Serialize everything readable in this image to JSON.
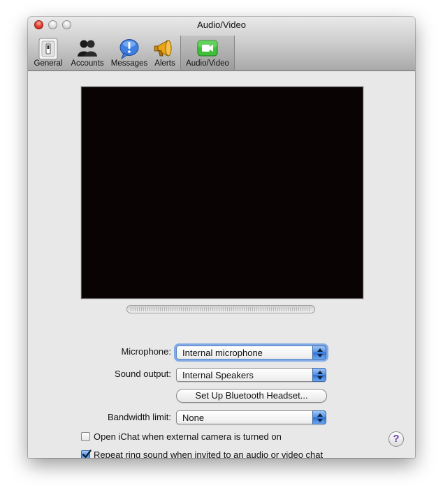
{
  "window": {
    "title": "Audio/Video"
  },
  "toolbar": {
    "items": [
      {
        "label": "General",
        "icon": "general-switch-icon",
        "selected": false
      },
      {
        "label": "Accounts",
        "icon": "accounts-people-icon",
        "selected": false
      },
      {
        "label": "Messages",
        "icon": "messages-exclamation-icon",
        "selected": false
      },
      {
        "label": "Alerts",
        "icon": "alerts-megaphone-icon",
        "selected": false
      },
      {
        "label": "Audio/Video",
        "icon": "video-camera-icon",
        "selected": true
      }
    ]
  },
  "form": {
    "microphone": {
      "label": "Microphone:",
      "value": "Internal microphone"
    },
    "sound_output": {
      "label": "Sound output:",
      "value": "Internal Speakers"
    },
    "bluetooth_button": "Set Up Bluetooth Headset...",
    "bandwidth": {
      "label": "Bandwidth limit:",
      "value": "None"
    }
  },
  "checkboxes": {
    "open_ichat": {
      "label": "Open iChat when external camera is turned on",
      "checked": false
    },
    "repeat_ring": {
      "label": "Repeat ring sound when invited to an audio or video chat",
      "checked": true
    }
  },
  "help": {
    "glyph": "?"
  },
  "colors": {
    "accent_blue": "#4f8fe3",
    "close_red": "#e8493a",
    "video_bg": "#0a0303",
    "help_purple": "#6a3fb0"
  }
}
